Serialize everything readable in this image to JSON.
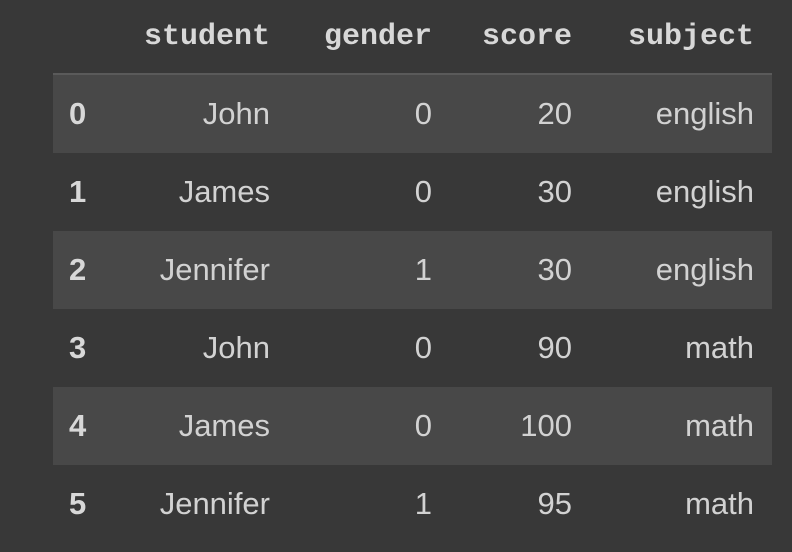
{
  "table": {
    "columns": [
      "",
      "student",
      "gender",
      "score",
      "subject"
    ],
    "rows": [
      {
        "index": "0",
        "student": "John",
        "gender": "0",
        "score": "20",
        "subject": "english"
      },
      {
        "index": "1",
        "student": "James",
        "gender": "0",
        "score": "30",
        "subject": "english"
      },
      {
        "index": "2",
        "student": "Jennifer",
        "gender": "1",
        "score": "30",
        "subject": "english"
      },
      {
        "index": "3",
        "student": "John",
        "gender": "0",
        "score": "90",
        "subject": "math"
      },
      {
        "index": "4",
        "student": "James",
        "gender": "0",
        "score": "100",
        "subject": "math"
      },
      {
        "index": "5",
        "student": "Jennifer",
        "gender": "1",
        "score": "95",
        "subject": "math"
      }
    ]
  },
  "colors": {
    "background": "#383838",
    "row_stripe": "#484848",
    "text": "#d2d2d2",
    "header_rule": "#5a5a5a"
  }
}
